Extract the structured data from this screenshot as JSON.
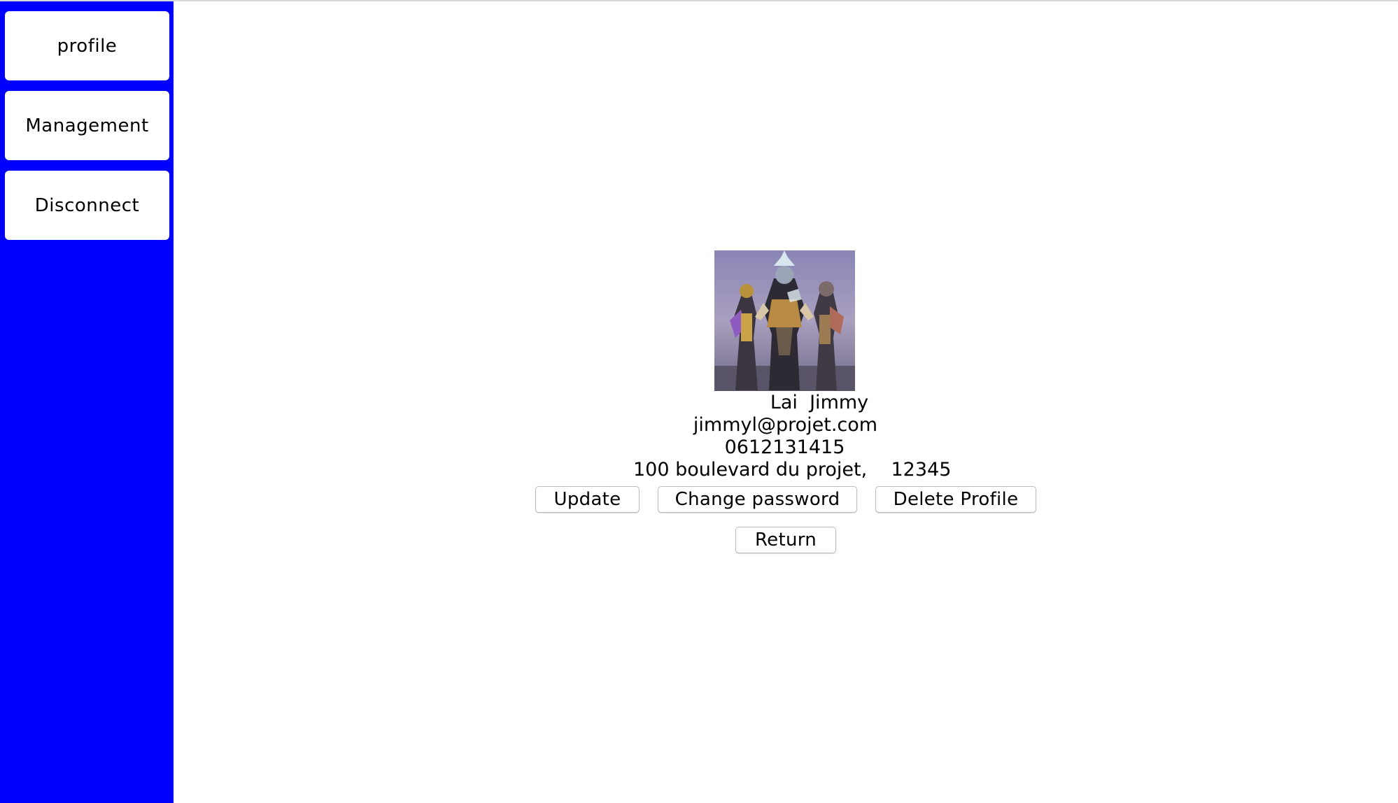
{
  "sidebar": {
    "background_color": "#0000ff",
    "items": [
      {
        "label": "profile"
      },
      {
        "label": "Management"
      },
      {
        "label": "Disconnect"
      }
    ]
  },
  "profile": {
    "avatar_icon": "avatar-image",
    "last_name": "Lai",
    "first_name": "Jimmy",
    "name_display": "Lai  Jimmy",
    "email": "jimmyl@projet.com",
    "phone": "0612131415",
    "address_display": "100 boulevard du projet,    12345"
  },
  "actions": {
    "update_label": "Update",
    "change_password_label": "Change password",
    "delete_profile_label": "Delete Profile",
    "return_label": "Return"
  }
}
